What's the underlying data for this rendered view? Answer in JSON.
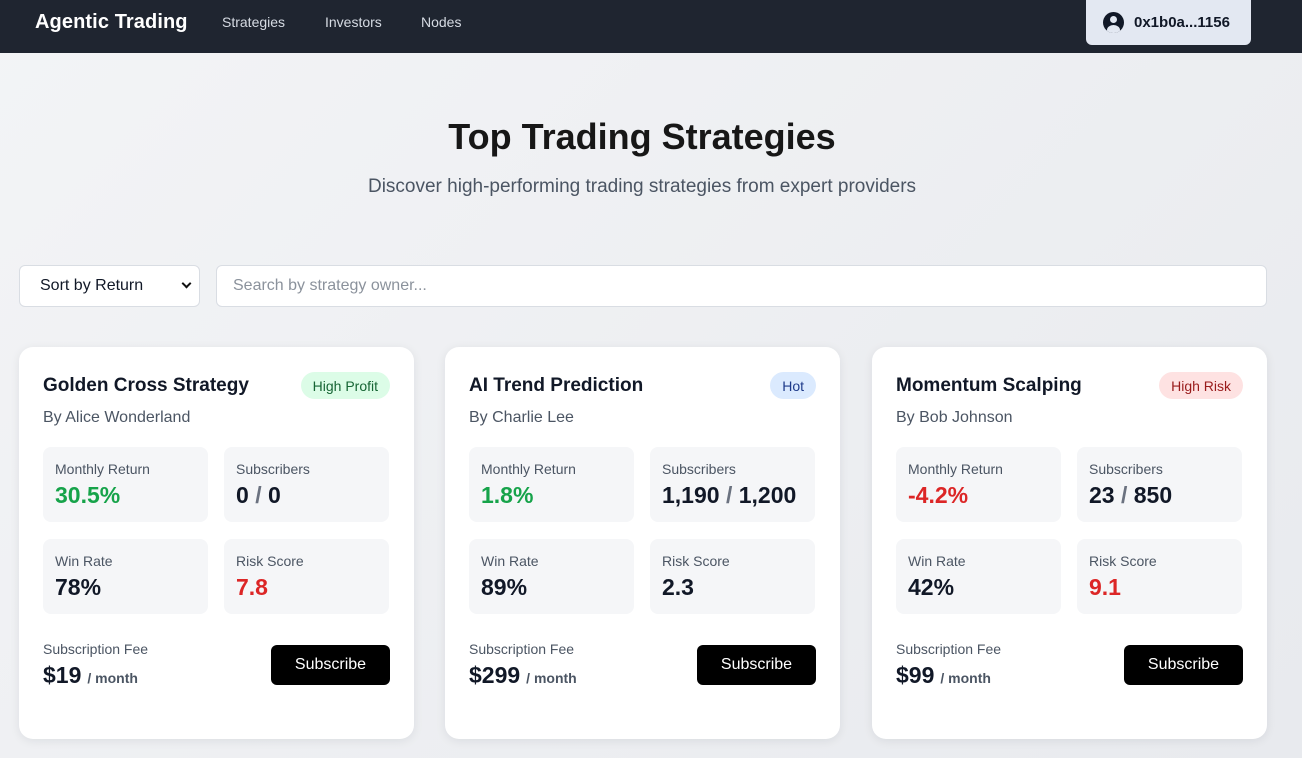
{
  "nav": {
    "brand": "Agentic Trading",
    "links": [
      "Strategies",
      "Investors",
      "Nodes"
    ],
    "wallet": "0x1b0a...1156",
    "wallet_icon": "user-circle-icon"
  },
  "hero": {
    "title": "Top Trading Strategies",
    "subtitle": "Discover high-performing trading strategies from expert providers"
  },
  "filters": {
    "sort_selected": "Sort by Return",
    "search_placeholder": "Search by strategy owner..."
  },
  "labels": {
    "monthly_return": "Monthly Return",
    "subscribers": "Subscribers",
    "win_rate": "Win Rate",
    "risk_score": "Risk Score",
    "fee": "Subscription Fee",
    "per_month": "/ month",
    "subscribe": "Subscribe",
    "slash": "/"
  },
  "colors": {
    "positive": "#16a34a",
    "negative": "#dc2626",
    "navbar": "#1f2530"
  },
  "strategies": [
    {
      "name": "Golden Cross Strategy",
      "badge": "High Profit",
      "owner": "By Alice Wonderland",
      "monthly_return": "30.5%",
      "subscribers_current": "0",
      "subscribers_max": "0",
      "win_rate": "78%",
      "risk_score": "7.8",
      "fee": "$19"
    },
    {
      "name": "AI Trend Prediction",
      "badge": "Hot",
      "owner": "By Charlie Lee",
      "monthly_return": "1.8%",
      "subscribers_current": "1,190",
      "subscribers_max": "1,200",
      "win_rate": "89%",
      "risk_score": "2.3",
      "fee": "$299"
    },
    {
      "name": "Momentum Scalping",
      "badge": "High Risk",
      "owner": "By Bob Johnson",
      "monthly_return": "-4.2%",
      "subscribers_current": "23",
      "subscribers_max": "850",
      "win_rate": "42%",
      "risk_score": "9.1",
      "fee": "$99"
    }
  ]
}
